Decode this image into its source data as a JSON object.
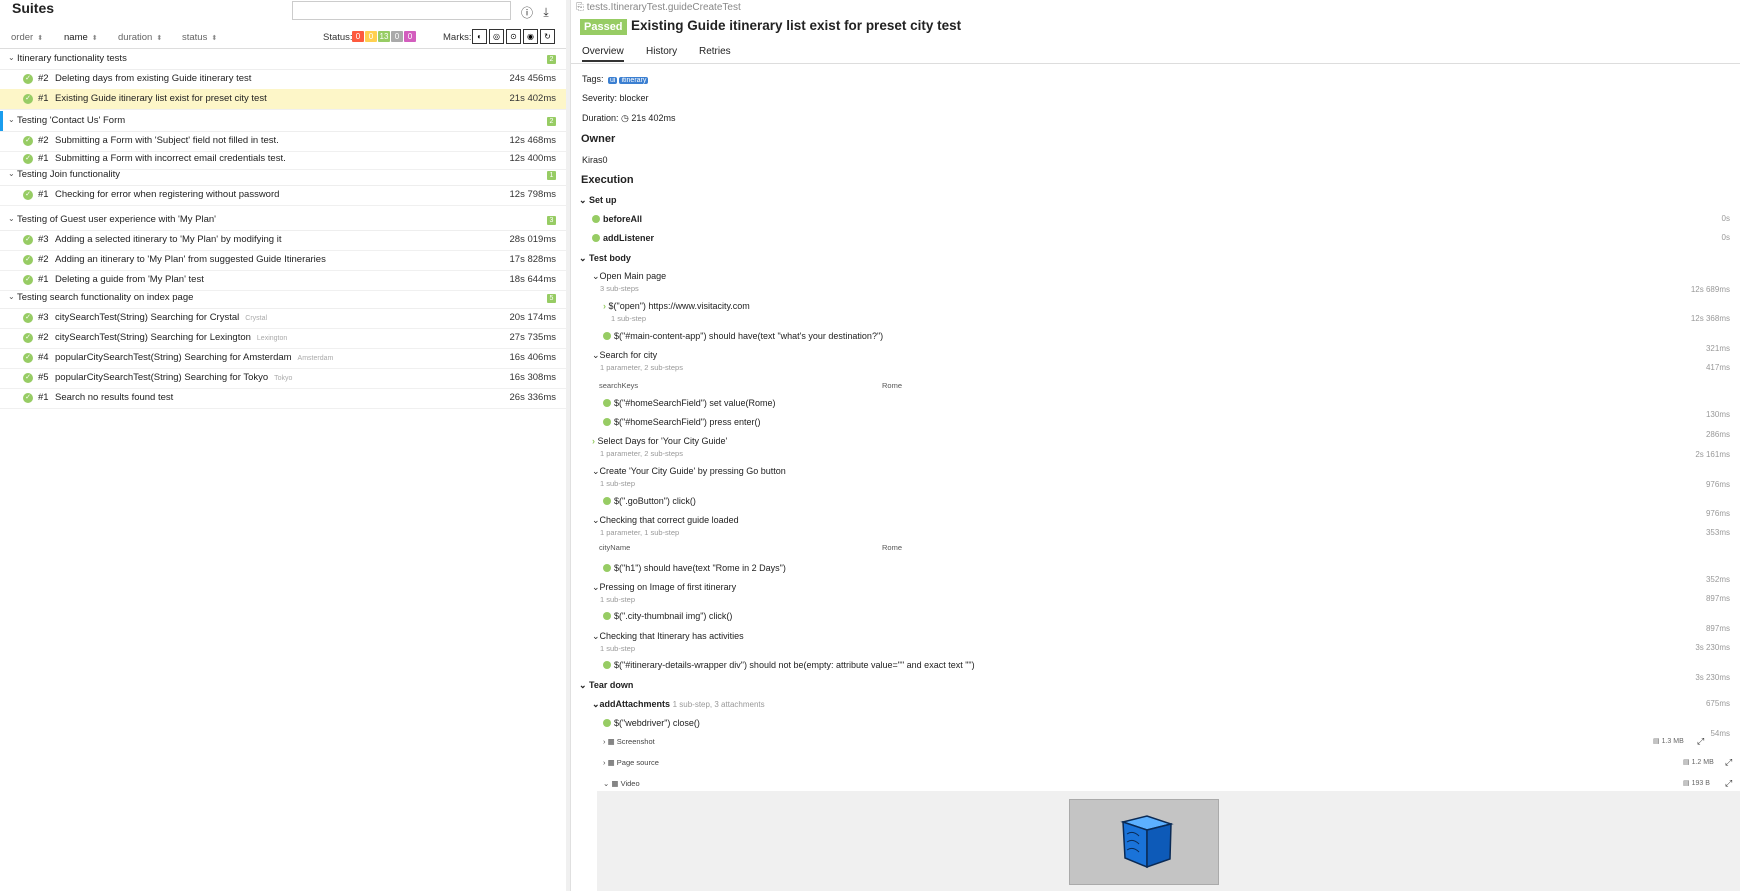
{
  "left": {
    "title": "Suites",
    "search": {
      "value": "",
      "placeholder": ""
    },
    "sort": {
      "order": "order",
      "name": "name",
      "duration": "duration",
      "status": "status"
    },
    "status_label": "Status:",
    "status_counts": [
      {
        "value": "0",
        "color": "#fd5a3e"
      },
      {
        "value": "0",
        "color": "#ffd050"
      },
      {
        "value": "13",
        "color": "#97cc64"
      },
      {
        "value": "0",
        "color": "#aaaaaa"
      },
      {
        "value": "0",
        "color": "#d35ebe"
      }
    ],
    "marks_label": "Marks:",
    "groups": [
      {
        "title": "Itinerary functionality tests",
        "count": "2",
        "rows": [
          {
            "num": "#2",
            "title": "Deleting days from existing Guide itinerary test",
            "param": "",
            "duration": "24s 456ms",
            "selected": false
          },
          {
            "num": "#1",
            "title": "Existing Guide itinerary list exist for preset city test",
            "param": "",
            "duration": "21s 402ms",
            "selected": true
          }
        ]
      },
      {
        "title": "Testing 'Contact Us' Form",
        "count": "2",
        "rows": [
          {
            "num": "#2",
            "title": "Submitting a Form with 'Subject' field not filled in test.",
            "param": "",
            "duration": "12s 468ms",
            "selected": false
          },
          {
            "num": "#1",
            "title": "Submitting a Form with incorrect email credentials test.",
            "param": "",
            "duration": "12s 400ms",
            "selected": false
          }
        ]
      },
      {
        "title": "Testing Join functionality",
        "count": "1",
        "rows": [
          {
            "num": "#1",
            "title": "Checking for error when registering without password",
            "param": "",
            "duration": "12s 798ms",
            "selected": false
          }
        ]
      },
      {
        "title": "Testing of Guest user experience with 'My Plan'",
        "count": "3",
        "rows": [
          {
            "num": "#3",
            "title": "Adding a selected itinerary to 'My Plan' by modifying it",
            "param": "",
            "duration": "28s 019ms",
            "selected": false
          },
          {
            "num": "#2",
            "title": "Adding an itinerary to 'My Plan' from suggested Guide Itineraries",
            "param": "",
            "duration": "17s 828ms",
            "selected": false
          },
          {
            "num": "#1",
            "title": "Deleting a guide from 'My Plan' test",
            "param": "",
            "duration": "18s 644ms",
            "selected": false
          }
        ]
      },
      {
        "title": "Testing search functionality on index page",
        "count": "5",
        "rows": [
          {
            "num": "#3",
            "title": "citySearchTest(String) Searching for Crystal",
            "param": "Crystal",
            "duration": "20s 174ms",
            "selected": false
          },
          {
            "num": "#2",
            "title": "citySearchTest(String) Searching for Lexington",
            "param": "Lexington",
            "duration": "27s 735ms",
            "selected": false
          },
          {
            "num": "#4",
            "title": "popularCitySearchTest(String) Searching for Amsterdam",
            "param": "Amsterdam",
            "duration": "16s 406ms",
            "selected": false
          },
          {
            "num": "#5",
            "title": "popularCitySearchTest(String) Searching for Tokyo",
            "param": "Tokyo",
            "duration": "16s 308ms",
            "selected": false
          },
          {
            "num": "#1",
            "title": "Search no results found test",
            "param": "",
            "duration": "26s 336ms",
            "selected": false
          }
        ]
      }
    ]
  },
  "right": {
    "breadcrumb": "tests.ItineraryTest.guideCreateTest",
    "status": "Passed",
    "title": "Existing Guide itinerary list exist for preset city test",
    "tabs": [
      "Overview",
      "History",
      "Retries"
    ],
    "tags_label": "Tags:",
    "tags": [
      "ui",
      "itinerary"
    ],
    "severity": "Severity: blocker",
    "duration_label": "Duration:",
    "duration": "21s 402ms",
    "owner_heading": "Owner",
    "owner": "Kiras0",
    "execution_heading": "Execution",
    "setup_label": "Set up",
    "setup": [
      {
        "name": "beforeAll",
        "time": "0s"
      },
      {
        "name": "addListener",
        "time": "0s"
      }
    ],
    "body_label": "Test body",
    "steps": [
      {
        "name": "Open Main page",
        "sub": "3 sub-steps",
        "time": "12s 689ms"
      },
      {
        "name": "$(\"open\") https://www.visitacity.com",
        "sub": "1 sub-step",
        "time": "12s 368ms"
      },
      {
        "name": "$(\"#main-content-app\") should have(text \"what's your destination?\")",
        "sub": "",
        "time": "321ms"
      },
      {
        "name": "Search for city",
        "sub": "1 parameter, 2 sub-steps",
        "time": "417ms"
      },
      {
        "name": "$(\"#homeSearchField\") set value(Rome)",
        "sub": "",
        "time": "130ms"
      },
      {
        "name": "$(\"#homeSearchField\") press enter()",
        "sub": "",
        "time": "286ms"
      },
      {
        "name": "Select Days for 'Your City Guide'",
        "sub": "1 parameter, 2 sub-steps",
        "time": "2s 161ms"
      },
      {
        "name": "Create 'Your City Guide' by pressing Go button",
        "sub": "1 sub-step",
        "time": "976ms"
      },
      {
        "name": "$(\".goButton\") click()",
        "sub": "",
        "time": "976ms"
      },
      {
        "name": "Checking that correct guide loaded",
        "sub": "1 parameter, 1 sub-step",
        "time": "353ms"
      },
      {
        "name": "$(\"h1\") should have(text \"Rome in 2 Days\")",
        "sub": "",
        "time": "352ms"
      },
      {
        "name": "Pressing on Image of first itinerary",
        "sub": "1 sub-step",
        "time": "897ms"
      },
      {
        "name": "$(\".city-thumbnail img\") click()",
        "sub": "",
        "time": "897ms"
      },
      {
        "name": "Checking that Itinerary has activities",
        "sub": "1 sub-step",
        "time": "3s 230ms"
      },
      {
        "name": "$(\"#itinerary-details-wrapper div\") should not be(empty: attribute value=\"\" and exact text \"\")",
        "sub": "",
        "time": "3s 230ms"
      }
    ],
    "params": [
      {
        "key": "searchKeys",
        "value": "Rome"
      },
      {
        "key": "cityName",
        "value": "Rome"
      }
    ],
    "teardown_label": "Tear down",
    "teardown": {
      "name": "addAttachments",
      "sub": "1 sub-step, 3 attachments",
      "time": "675ms",
      "close": {
        "name": "$(\"webdriver\") close()",
        "time": "54ms"
      },
      "attachments": [
        {
          "name": "Screenshot",
          "size": "1.3 MB"
        },
        {
          "name": "Page source",
          "size": "1.2 MB"
        },
        {
          "name": "Video",
          "size": "193 B"
        }
      ]
    }
  }
}
